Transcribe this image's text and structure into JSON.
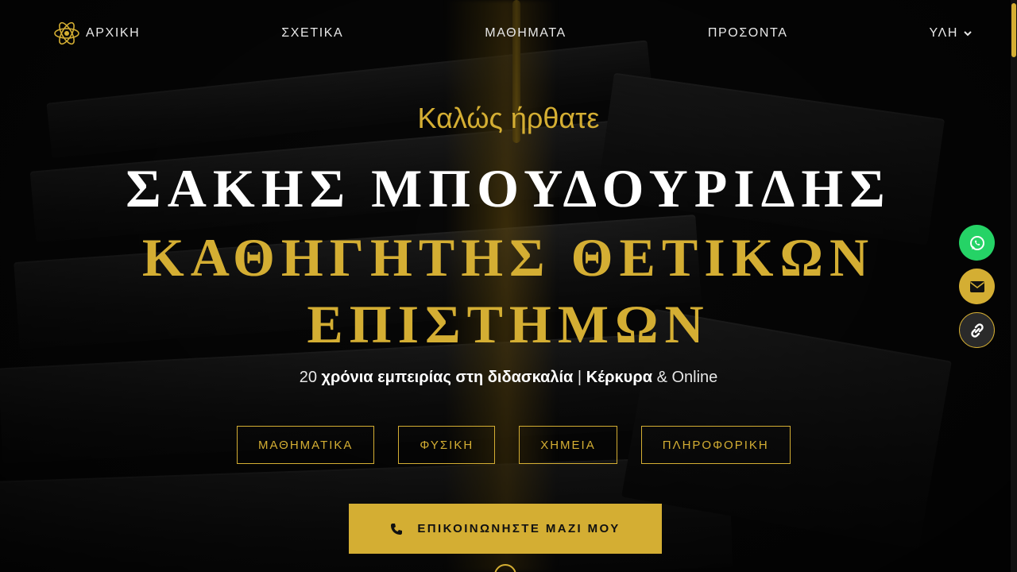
{
  "nav": {
    "logo_icon": "atom-icon",
    "items": [
      {
        "label": "ΑΡΧΙΚΗ"
      },
      {
        "label": "ΣΧΕΤΙΚΑ"
      },
      {
        "label": "ΜΑΘΗΜΑΤΑ"
      },
      {
        "label": "ΠΡΟΣΟΝΤΑ"
      },
      {
        "label": "ΥΛΗ",
        "icon": "chevron-down-icon"
      }
    ]
  },
  "hero": {
    "welcome": "Καλώς ήρθατε",
    "name": "ΣΑΚΗΣ ΜΠΟΥΔΟΥΡΙΔΗΣ",
    "role": "ΚΑΘΗΓΗΤΗΣ ΘΕΤΙΚΩΝ ΕΠΙΣΤΗΜΩΝ",
    "tagline": {
      "years": "20",
      "experience": "χρόνια εμπειρίας στη διδασκαλία",
      "separator": "|",
      "city": "Κέρκυρα",
      "online": "& Online"
    },
    "subjects": [
      "ΜΑΘΗΜΑΤΙΚΑ",
      "ΦΥΣΙΚΗ",
      "ΧΗΜΕΙΑ",
      "ΠΛΗΡΟΦΟΡΙΚΗ"
    ],
    "cta": {
      "label": "ΕΠΙΚΟΙΝΩΝΗΣΤΕ ΜΑΖΙ ΜΟΥ",
      "icon": "phone-icon"
    }
  },
  "floating": [
    {
      "icon": "whatsapp-icon",
      "color": "#25d366"
    },
    {
      "icon": "envelope-icon",
      "color": "#d4ae33"
    },
    {
      "icon": "link-icon",
      "color": "#2a2a2a"
    }
  ],
  "colors": {
    "accent": "#d4ae33",
    "background": "#0b0b0b",
    "whatsapp": "#25d366"
  }
}
